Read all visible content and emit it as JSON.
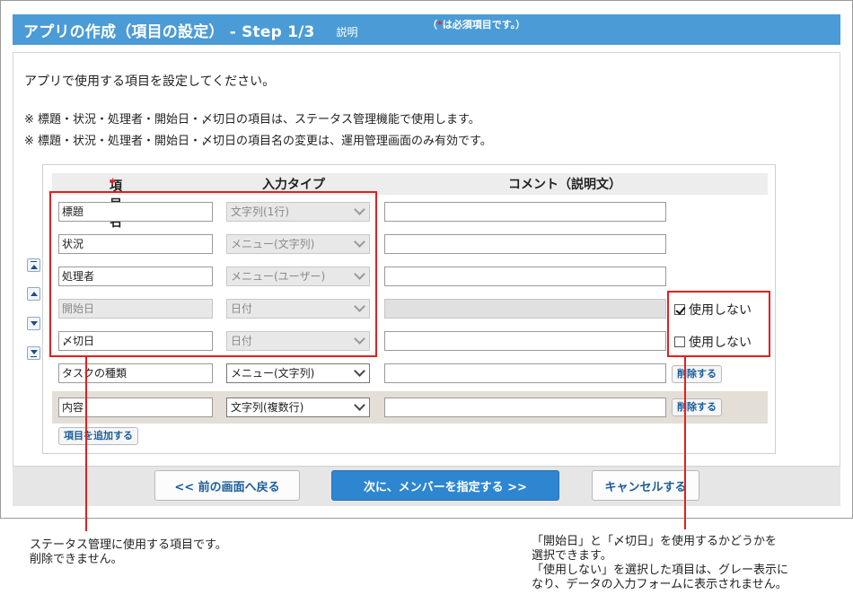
{
  "header": {
    "title": "アプリの作成（項目の設定） - Step 1/3",
    "help_link": "説明",
    "req_prefix": "（",
    "req_star": "*",
    "req_suffix": "は必須項目です。）"
  },
  "intro": "アプリで使用する項目を設定してください。",
  "notes": [
    "※ 標題・状況・処理者・開始日・〆切日の項目は、ステータス管理機能で使用します。",
    "※ 標題・状況・処理者・開始日・〆切日の項目名の変更は、運用管理画面のみ有効です。"
  ],
  "columns": {
    "name": "項目名",
    "required_mark": "*",
    "type": "入力タイプ",
    "comment": "コメント（説明文）"
  },
  "rows": [
    {
      "name": "標題",
      "type": "文字列(1行)"
    },
    {
      "name": "状況",
      "type": "メニュー(文字列)"
    },
    {
      "name": "処理者",
      "type": "メニュー(ユーザー)"
    },
    {
      "name": "開始日",
      "type": "日付",
      "unused_label": "使用しない",
      "unused_checked": true
    },
    {
      "name": "〆切日",
      "type": "日付",
      "unused_label": "使用しない",
      "unused_checked": false
    },
    {
      "name": "タスクの種類",
      "type": "メニュー(文字列)",
      "delete_label": "削除する"
    },
    {
      "name": "内容",
      "type": "文字列(複数行)",
      "delete_label": "削除する"
    }
  ],
  "add_item_label": "項目を追加する",
  "footer": {
    "back": "<< 前の画面へ戻る",
    "next": "次に、メンバーを指定する >>",
    "cancel": "キャンセルする"
  },
  "annotations": {
    "left": [
      "ステータス管理に使用する項目です。",
      "削除できません。"
    ],
    "right": [
      "「開始日」と「〆切日」を使用するかどうかを",
      "選択できます。",
      "「使用しない」を選択した項目は、グレー表示に",
      "なり、データの入力フォームに表示されません。"
    ]
  },
  "colors": {
    "header": "#4b9bd6",
    "primary": "#2e86d1",
    "highlight": "#e02020"
  }
}
